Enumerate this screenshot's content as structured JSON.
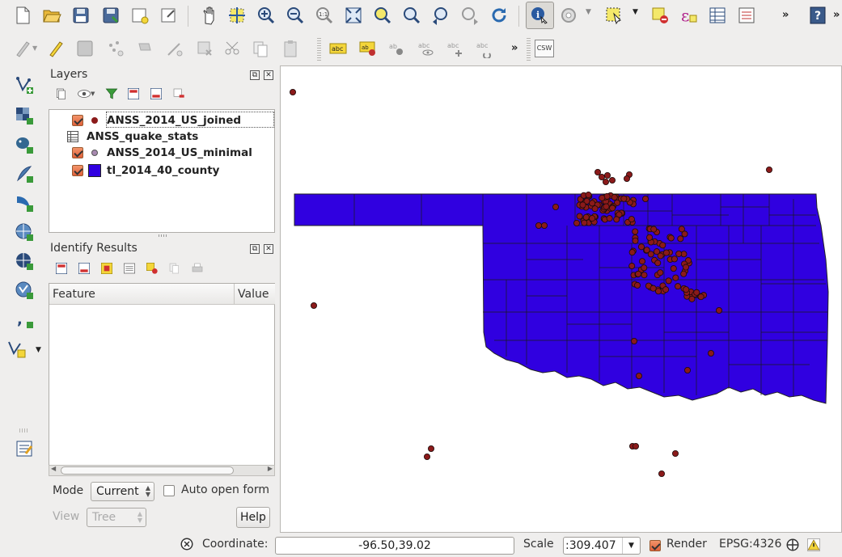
{
  "toolbar1": {
    "icons": [
      "new-project-icon",
      "open-project-icon",
      "save-project-icon",
      "save-as-icon",
      "new-print-composer-icon",
      "composer-manager-icon",
      "pan-icon",
      "pan-to-selection-icon",
      "zoom-in-icon",
      "zoom-out-icon",
      "zoom-native-icon",
      "zoom-full-icon",
      "zoom-to-selection-icon",
      "zoom-to-layer-icon",
      "zoom-last-icon",
      "zoom-next-icon",
      "refresh-icon",
      "identify-icon",
      "action-icon",
      "select-feature-icon",
      "deselect-icon",
      "expression-select-icon",
      "attribute-table-icon",
      "statistics-icon",
      "help-icon"
    ]
  },
  "toolbar2": {
    "csw_label": "CSW"
  },
  "layers": {
    "title": "Layers",
    "items": [
      {
        "name": "ANSS_2014_US_joined",
        "type": "point",
        "color": "#8b1a1a",
        "checked": true
      },
      {
        "name": "ANSS_quake_stats",
        "type": "table",
        "checked": false
      },
      {
        "name": "ANSS_2014_US_minimal",
        "type": "point",
        "color": "#a889b0",
        "checked": true
      },
      {
        "name": "tl_2014_40_county",
        "type": "polygon",
        "color": "#3000e0",
        "checked": true
      }
    ]
  },
  "identify": {
    "title": "Identify Results",
    "col_feature": "Feature",
    "col_value": "Value",
    "mode_label": "Mode",
    "mode_value": "Current",
    "auto_open_label": "Auto open form",
    "view_label": "View",
    "view_value": "Tree",
    "help_label": "Help"
  },
  "status": {
    "coordinate_label": "Coordinate:",
    "coordinate_value": "-96.50,39.02",
    "scale_label": "Scale",
    "scale_value": ":309.407",
    "render_label": "Render",
    "crs": "EPSG:4326"
  },
  "map": {
    "county_fill": "#3000e0",
    "point_fill": "#8b1a1a"
  }
}
